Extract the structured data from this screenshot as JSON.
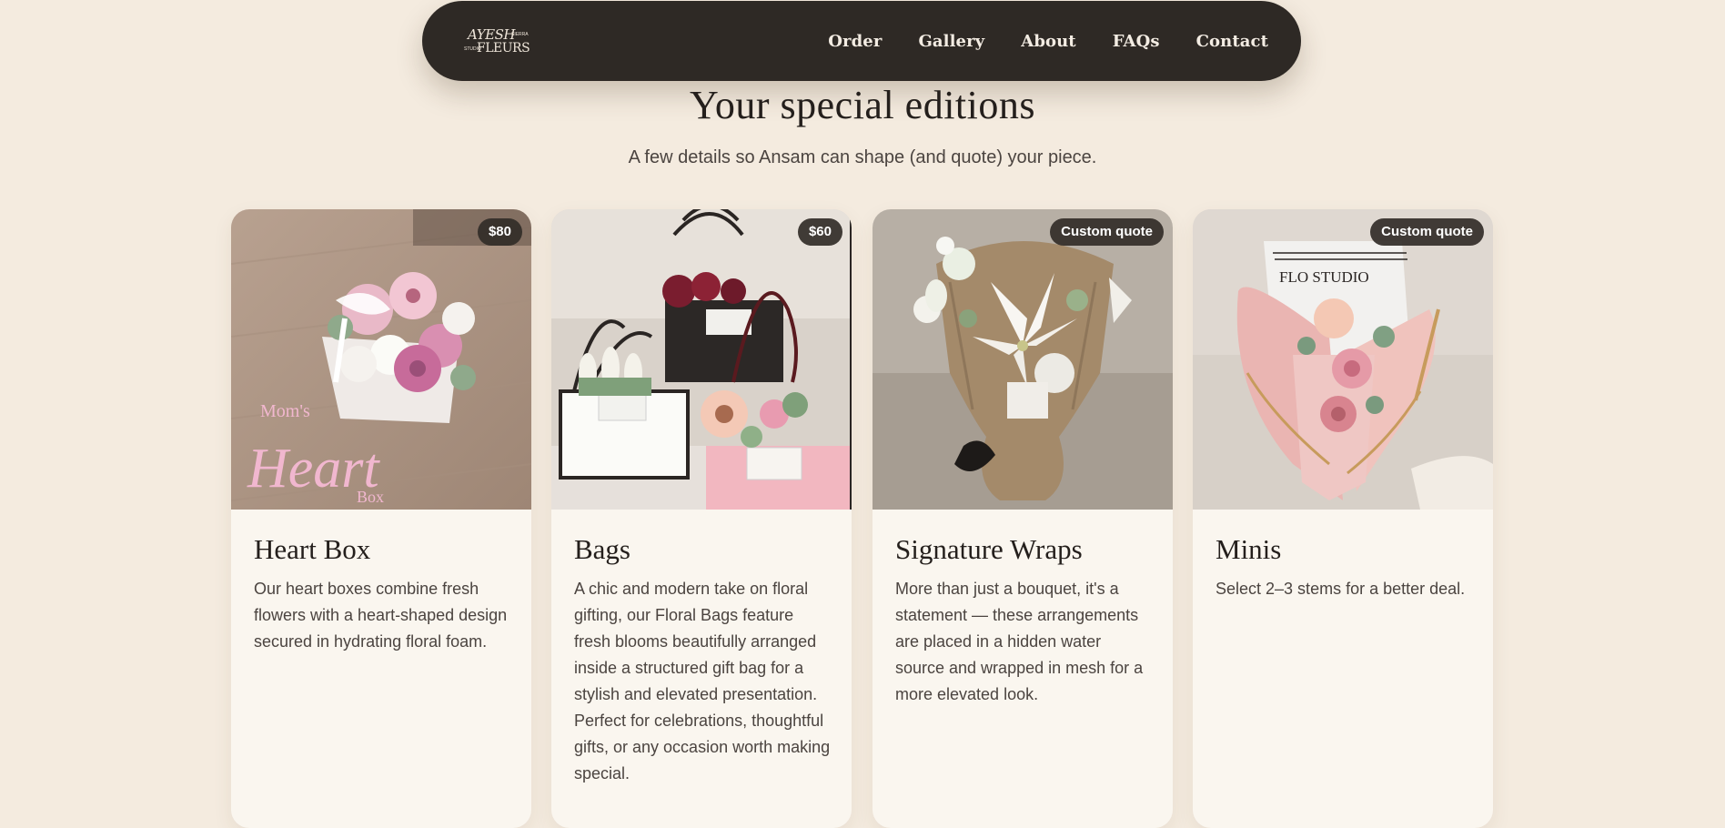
{
  "nav": {
    "logo": {
      "line1": "AYESH",
      "line2": "FLEURS",
      "small1": "SIERRA",
      "small2": "STUDIO"
    },
    "links": [
      "Order",
      "Gallery",
      "About",
      "FAQs",
      "Contact"
    ]
  },
  "section": {
    "title": "Your special editions",
    "subtitle": "A few details so Ansam can shape (and quote) your piece."
  },
  "cards": [
    {
      "title": "Heart Box",
      "badge": "$80",
      "image_text": {
        "line1": "Mom's",
        "line2": "Heart",
        "line3": "Box"
      },
      "description": "Our heart boxes combine fresh flowers with a heart-shaped design secured in hydrating floral foam."
    },
    {
      "title": "Bags",
      "badge": "$60",
      "description": "A chic and modern take on floral gifting, our Floral Bags feature fresh blooms beautifully arranged inside a structured gift bag for a stylish and elevated presentation. Perfect for celebrations, thoughtful gifts, or any occasion worth making special."
    },
    {
      "title": "Signature Wraps",
      "badge": "Custom quote",
      "description": "More than just a bouquet, it's a statement — these arrangements are placed in a hidden water source and wrapped in mesh for a more elevated look."
    },
    {
      "title": "Minis",
      "badge": "Custom quote",
      "image_text": {
        "paper": "FLO STUDIO"
      },
      "description": "Select 2–3 stems for a better deal."
    }
  ]
}
